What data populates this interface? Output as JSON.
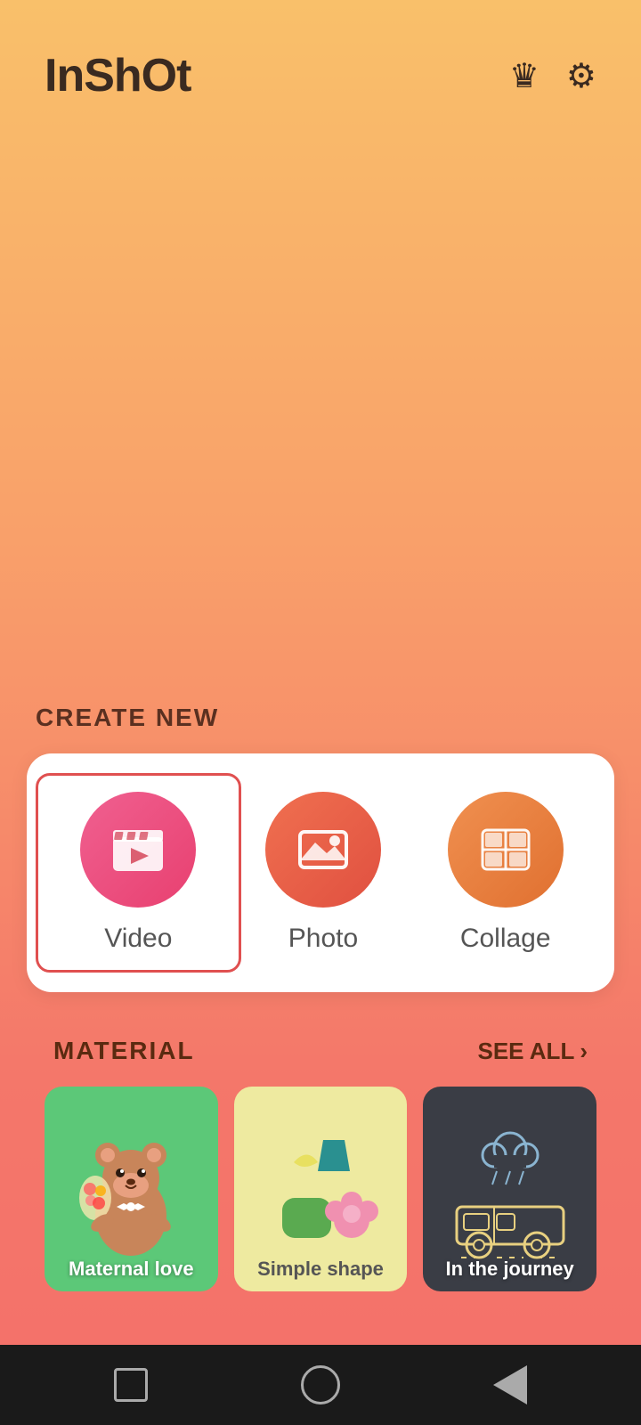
{
  "app": {
    "name": "InShOt"
  },
  "header": {
    "logo": "InShOt",
    "crown_icon": "👑",
    "settings_icon": "⚙"
  },
  "create_new": {
    "section_label": "CREATE NEW",
    "items": [
      {
        "id": "video",
        "label": "Video",
        "selected": true
      },
      {
        "id": "photo",
        "label": "Photo",
        "selected": false
      },
      {
        "id": "collage",
        "label": "Collage",
        "selected": false
      }
    ]
  },
  "material": {
    "section_label": "MATERIAL",
    "see_all_label": "SEE ALL",
    "items": [
      {
        "id": "maternal-love",
        "label": "Maternal love",
        "bg": "green"
      },
      {
        "id": "simple-shape",
        "label": "Simple shape",
        "bg": "yellow"
      },
      {
        "id": "in-the-journey",
        "label": "In the journey",
        "bg": "dark"
      }
    ]
  },
  "nav": {
    "square_label": "square-nav",
    "circle_label": "home-nav",
    "triangle_label": "back-nav"
  }
}
